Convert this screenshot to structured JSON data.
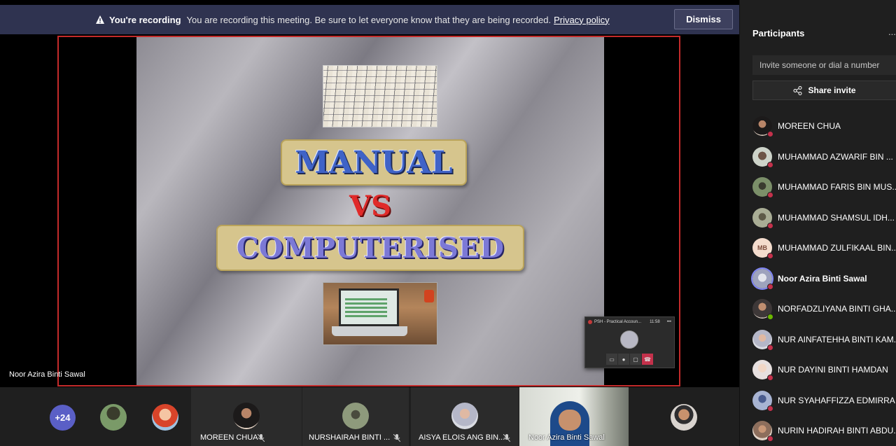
{
  "recording_banner": {
    "title": "You're recording",
    "message": "You are recording this meeting. Be sure to let everyone know that they are being recorded.",
    "link": "Privacy policy",
    "dismiss": "Dismiss"
  },
  "slide": {
    "line1": "MANUAL",
    "line2": "VS",
    "line3": "COMPUTERISED"
  },
  "presenter_label": "Noor Azira Binti Sawal",
  "mini_window": {
    "title": "PSH - Practical Accoun...",
    "time": "11:58"
  },
  "gallery": {
    "more_count": "+24",
    "tiles": [
      {
        "name": "MOREEN CHUA"
      },
      {
        "name": "NURSHAIRAH BINTI ..."
      },
      {
        "name": "AISYA ELOIS ANG BIN..."
      },
      {
        "name": "Noor Azira Binti Sawal"
      }
    ]
  },
  "panel": {
    "title": "Participants",
    "more": "...",
    "invite_placeholder": "Invite someone or dial a number",
    "share_invite": "Share invite",
    "participants": [
      {
        "name": "MOREEN CHUA",
        "initials": ""
      },
      {
        "name": "MUHAMMAD AZWARIF BIN ...",
        "initials": ""
      },
      {
        "name": "MUHAMMAD FARIS BIN MUS...",
        "initials": ""
      },
      {
        "name": "MUHAMMAD SHAMSUL IDH...",
        "initials": ""
      },
      {
        "name": "MUHAMMAD ZULFIKAAL BIN...",
        "initials": "MB"
      },
      {
        "name": "Noor Azira Binti Sawal",
        "initials": ""
      },
      {
        "name": "NORFADZLIYANA BINTI GHA...",
        "initials": ""
      },
      {
        "name": "NUR AINFATEHHA BINTI KAM...",
        "initials": ""
      },
      {
        "name": "NUR DAYINI BINTI HAMDAN",
        "initials": ""
      },
      {
        "name": "NUR SYAHAFFIZZA EDMIRRA ...",
        "initials": ""
      },
      {
        "name": "NURIN HADIRAH BINTI ABDU...",
        "initials": ""
      }
    ]
  },
  "colors": {
    "banner": "#2f3350",
    "accent": "#5a5fc6",
    "frame_border": "#c42b2b",
    "muted_badge": "#c4314b",
    "available_badge": "#6bb700"
  }
}
